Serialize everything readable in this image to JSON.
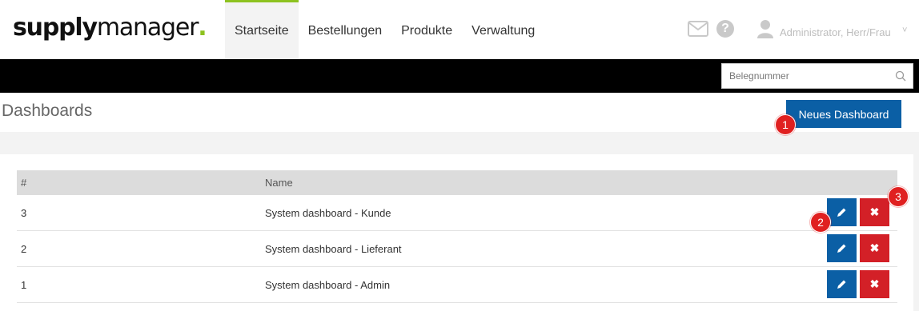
{
  "logo": {
    "bold": "supply",
    "light": "manager",
    "dot": "."
  },
  "nav": {
    "items": [
      {
        "label": "Startseite",
        "active": true
      },
      {
        "label": "Bestellungen",
        "active": false
      },
      {
        "label": "Produkte",
        "active": false
      },
      {
        "label": "Verwaltung",
        "active": false
      }
    ]
  },
  "header": {
    "help_glyph": "?",
    "user_name": "Administrator, Herr/Frau",
    "chevron": "˅"
  },
  "search": {
    "placeholder": "Belegnummer"
  },
  "page": {
    "title": "Dashboards",
    "new_button_label": "Neues Dashboard"
  },
  "table": {
    "headers": [
      "#",
      "Name"
    ],
    "rows": [
      {
        "num": "3",
        "name": "System dashboard - Kunde"
      },
      {
        "num": "2",
        "name": "System dashboard - Lieferant"
      },
      {
        "num": "1",
        "name": "System dashboard - Admin"
      }
    ],
    "delete_glyph": "✖"
  },
  "markers": [
    "1",
    "2",
    "3"
  ],
  "colors": {
    "accent_green": "#8dc21f",
    "primary_blue": "#0b5fa5",
    "danger_red": "#d32027",
    "marker_red": "#e02020"
  },
  "icons": {
    "mail": "mail-icon",
    "help": "help-icon",
    "user": "user-icon",
    "search": "search-icon",
    "edit": "pencil-icon",
    "delete": "close-icon"
  }
}
